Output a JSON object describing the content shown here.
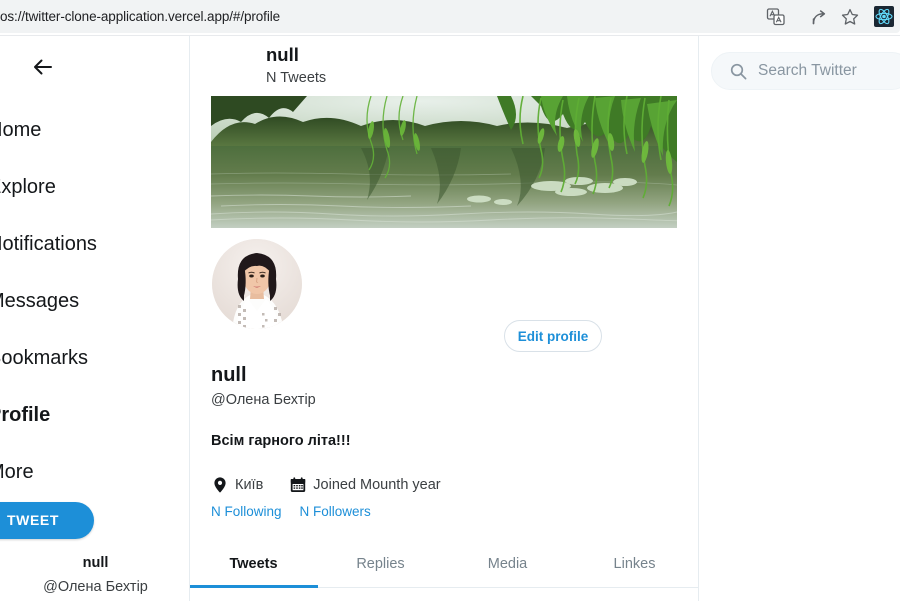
{
  "browser": {
    "url": "os://twitter-clone-application.vercel.app/#/profile",
    "icons": {
      "translate": "translate-icon",
      "share": "share-icon",
      "bookmark": "star-bookmark-icon",
      "extension": "react-devtools-extension-icon"
    }
  },
  "sidebar": {
    "items": [
      {
        "label": "Home",
        "active": false
      },
      {
        "label": "Explore",
        "active": false
      },
      {
        "label": "Notifications",
        "active": false
      },
      {
        "label": "Messages",
        "active": false
      },
      {
        "label": "Bookmarks",
        "active": false
      },
      {
        "label": "Profile",
        "active": true
      },
      {
        "label": "More",
        "active": false
      }
    ],
    "tweet_button": "TWEET",
    "user": {
      "name": "null",
      "handle": "@Олена Бехтір"
    }
  },
  "header": {
    "title": "null",
    "subtitle": "N Tweets",
    "back_icon": "arrow-left-icon"
  },
  "search": {
    "placeholder": "Search Twitter",
    "value": "",
    "icon": "search-icon"
  },
  "profile": {
    "banner_alt": "pond with willow branches",
    "avatar_alt": "portrait of woman in white embroidered blouse",
    "edit_button": "Edit profile",
    "name": "null",
    "handle": "@Олена Бехтір",
    "bio": "Всім гарного літа!!!",
    "location": "Київ",
    "location_icon": "map-pin-icon",
    "joined": "Joined Mounth year",
    "joined_icon": "calendar-icon",
    "following": "N Following",
    "followers": "N Followers",
    "tabs": [
      {
        "label": "Tweets",
        "active": true
      },
      {
        "label": "Replies",
        "active": false
      },
      {
        "label": "Media",
        "active": false
      },
      {
        "label": "Linkes",
        "active": false
      }
    ]
  },
  "colors": {
    "accent": "#1d8fd8",
    "text": "#14171a",
    "muted": "#3b3f42",
    "border": "#e6ecf0",
    "chrome_bar": "#f1f3f4",
    "search_bg": "#f5f8fa"
  }
}
